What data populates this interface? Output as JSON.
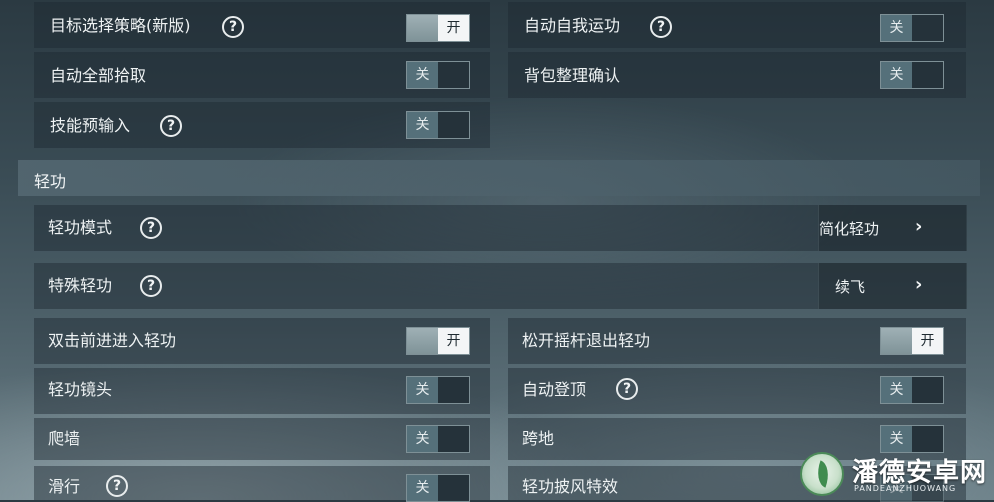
{
  "general": {
    "target_strategy": {
      "label": "目标选择策略(新版)",
      "state": "开"
    },
    "auto_self_exercise": {
      "label": "自动自我运功",
      "state": "关"
    },
    "auto_loot_all": {
      "label": "自动全部拾取",
      "state": "关"
    },
    "bag_sort_confirm": {
      "label": "背包整理确认",
      "state": "关"
    },
    "skill_preinput": {
      "label": "技能预输入",
      "state": "关"
    }
  },
  "section": {
    "title": "轻功"
  },
  "qinggong": {
    "mode": {
      "label": "轻功模式",
      "value": "简化轻功"
    },
    "special": {
      "label": "特殊轻功",
      "value": "续飞"
    },
    "double_tap_forward": {
      "label": "双击前进进入轻功",
      "state": "开"
    },
    "release_joystick_exit": {
      "label": "松开摇杆退出轻功",
      "state": "开"
    },
    "camera": {
      "label": "轻功镜头",
      "state": "关"
    },
    "auto_climb_top": {
      "label": "自动登顶",
      "state": "关"
    },
    "wall_climb": {
      "label": "爬墙",
      "state": "关"
    },
    "step_over": {
      "label": "跨地",
      "state": "关"
    },
    "glide": {
      "label": "滑行",
      "state": "关"
    },
    "cape_effect": {
      "label": "轻功披风特效",
      "state": "关"
    }
  },
  "help_glyph": "?",
  "chevron_glyph": "›",
  "watermark": {
    "title": "潘德安卓网",
    "subtitle": "PANDEANZHUOWANG"
  }
}
